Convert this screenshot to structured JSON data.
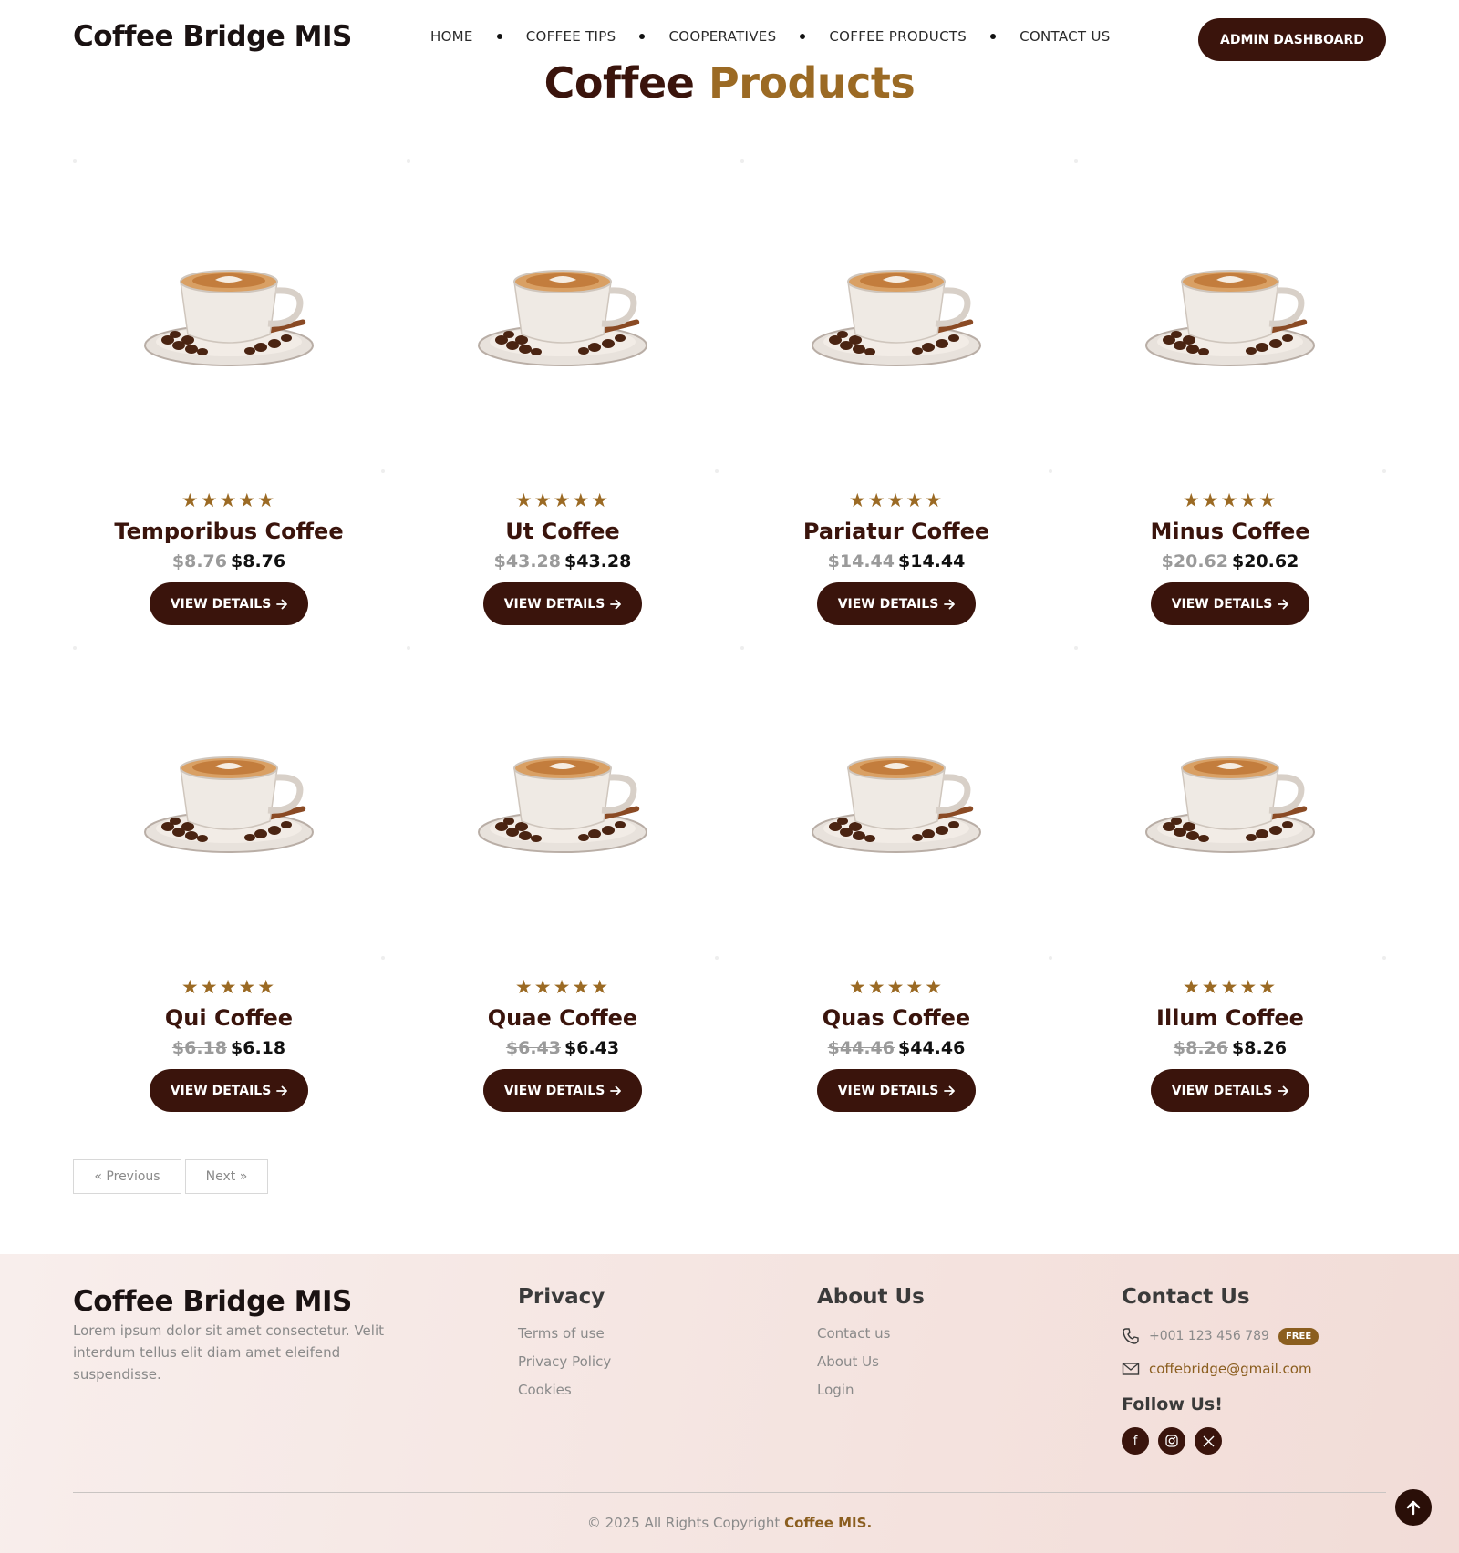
{
  "header": {
    "brand": "Coffee Bridge MIS",
    "nav": [
      "HOME",
      "COFFEE TIPS",
      "COOPERATIVES",
      "COFFEE PRODUCTS",
      "CONTACT US"
    ],
    "admin_button": "ADMIN DASHBOARD"
  },
  "page_title": {
    "part1": "Coffee",
    "part2": "Products"
  },
  "products": [
    {
      "name": "Temporibus Coffee",
      "old_price": "$8.76",
      "price": "$8.76",
      "stars": "★★★★★",
      "rating": 5,
      "button": "VIEW DETAILS"
    },
    {
      "name": "Ut Coffee",
      "old_price": "$43.28",
      "price": "$43.28",
      "stars": "★★★★★",
      "rating": 5,
      "button": "VIEW DETAILS"
    },
    {
      "name": "Pariatur Coffee",
      "old_price": "$14.44",
      "price": "$14.44",
      "stars": "★★★★★",
      "rating": 5,
      "button": "VIEW DETAILS"
    },
    {
      "name": "Minus Coffee",
      "old_price": "$20.62",
      "price": "$20.62",
      "stars": "★★★★★",
      "rating": 5,
      "button": "VIEW DETAILS"
    },
    {
      "name": "Qui Coffee",
      "old_price": "$6.18",
      "price": "$6.18",
      "stars": "★★★★★",
      "rating": 5,
      "button": "VIEW DETAILS"
    },
    {
      "name": "Quae Coffee",
      "old_price": "$6.43",
      "price": "$6.43",
      "stars": "★★★★★",
      "rating": 5,
      "button": "VIEW DETAILS"
    },
    {
      "name": "Quas Coffee",
      "old_price": "$44.46",
      "price": "$44.46",
      "stars": "★★★★★",
      "rating": 5,
      "button": "VIEW DETAILS"
    },
    {
      "name": "Illum Coffee",
      "old_price": "$8.26",
      "price": "$8.26",
      "stars": "★★★★★",
      "rating": 5,
      "button": "VIEW DETAILS"
    }
  ],
  "pagination": {
    "prev": "« Previous",
    "next": "Next »"
  },
  "footer": {
    "brand": "Coffee Bridge MIS",
    "description": "Lorem ipsum dolor sit amet consectetur. Velit interdum tellus elit diam amet eleifend suspendisse.",
    "privacy": {
      "title": "Privacy",
      "links": [
        "Terms of use",
        "Privacy Policy",
        "Cookies"
      ]
    },
    "about": {
      "title": "About Us",
      "links": [
        "Contact us",
        "About Us",
        "Login"
      ]
    },
    "contact": {
      "title": "Contact Us",
      "phone": "+001 123 456 789",
      "phone_badge": "FREE",
      "email": "coffebridge@gmail.com",
      "follow": "Follow Us!",
      "socials": [
        "facebook-icon",
        "instagram-icon",
        "x-icon"
      ]
    },
    "copyright_prefix": "© 2025 All Rights Copyright",
    "copyright_brand": "Coffee MIS."
  },
  "colors": {
    "primary_dark": "#3a140c",
    "accent_gold": "#9b6a24",
    "footer_bg": "#f4e3df"
  }
}
